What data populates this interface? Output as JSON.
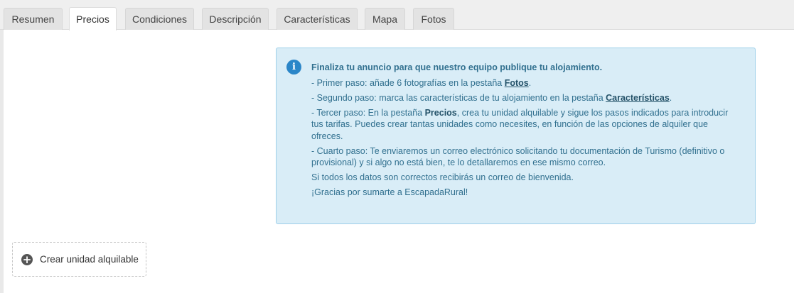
{
  "tabs": [
    {
      "label": "Resumen"
    },
    {
      "label": "Precios",
      "active": true
    },
    {
      "label": "Condiciones"
    },
    {
      "label": "Descripción"
    },
    {
      "label": "Características"
    },
    {
      "label": "Mapa"
    },
    {
      "label": "Fotos"
    }
  ],
  "info": {
    "icon": "info-icon",
    "icon_glyph": "i",
    "title": "Finaliza tu anuncio para que nuestro equipo publique tu alojamiento.",
    "step1_prefix": "- Primer paso: añade 6 fotografías en la pestaña ",
    "step1_link": "Fotos",
    "step1_suffix": ".",
    "step2_prefix": "- Segundo paso: marca las características de tu alojamiento en la pestaña ",
    "step2_link": "Características",
    "step2_suffix": ".",
    "step3_prefix": "- Tercer paso: En la pestaña ",
    "step3_bold": "Precios",
    "step3_suffix": ", crea tu unidad alquilable y sigue los pasos indicados para introducir tus tarifas. Puedes crear tantas unidades como necesites, en función de las opciones de alquiler que ofreces.",
    "step4": "- Cuarto paso: Te enviaremos un correo electrónico solicitando tu documentación de Turismo (definitivo o provisional) y si algo no está bien, te lo detallaremos en ese mismo correo.",
    "line_welcome": "Si todos los datos son correctos recibirás un correo de bienvenida.",
    "line_thanks": "¡Gracias por sumarte a EscapadaRural!"
  },
  "create_unit": {
    "icon": "plus-circle-icon",
    "icon_glyph": "+",
    "label": "Crear unidad alquilable"
  },
  "colors": {
    "info_bg": "#d9edf7",
    "info_text": "#31708f",
    "info_icon": "#2b86c8"
  }
}
